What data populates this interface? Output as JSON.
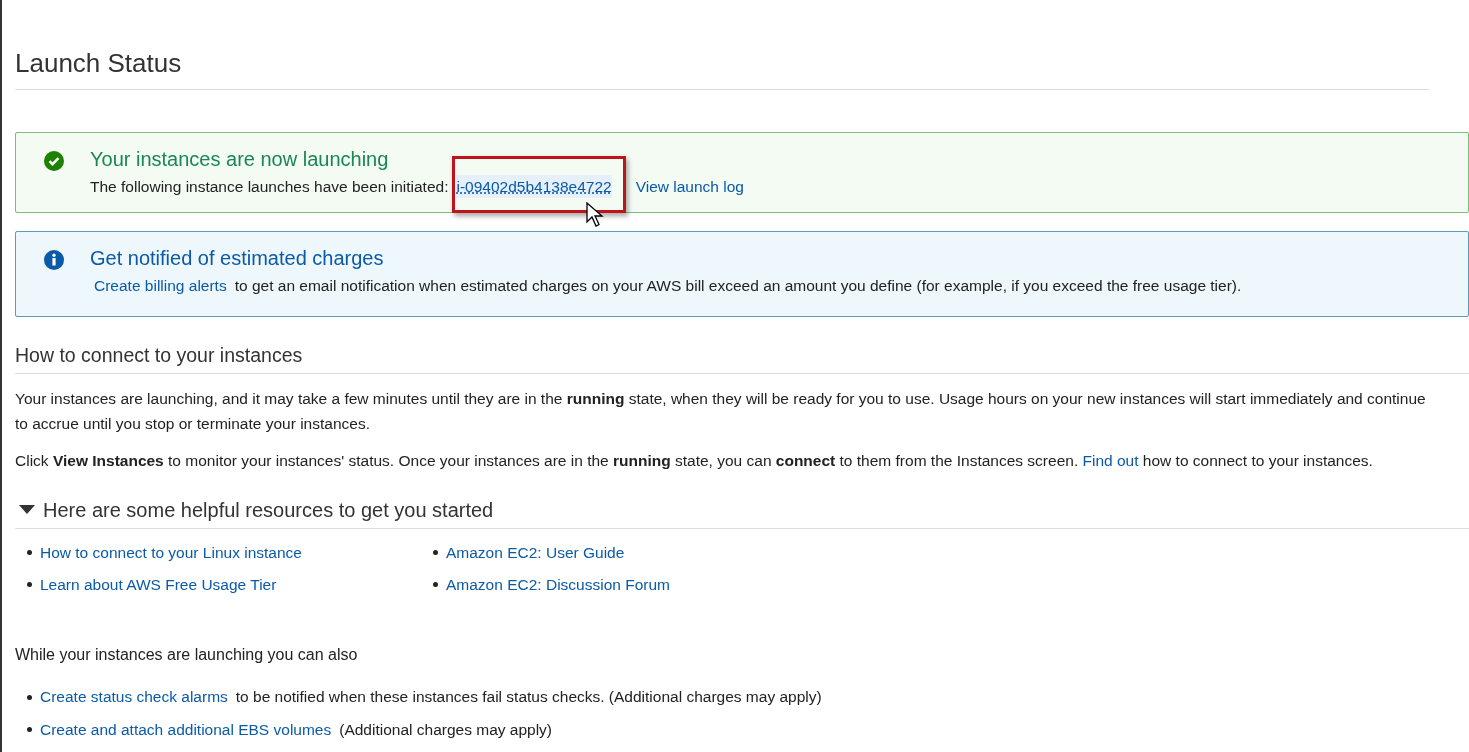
{
  "title": "Launch Status",
  "success_alert": {
    "heading": "Your instances are now launching",
    "text": "The following instance launches have been initiated:",
    "instance_link": "i-09402d5b4138e4722",
    "highlighted": true,
    "log_link": "View launch log"
  },
  "info_alert": {
    "heading": "Get notified of estimated charges",
    "link": "Create billing alerts",
    "text": "to get an email notification when estimated charges on your AWS bill exceed an amount you define (for example, if you exceed the free usage tier)."
  },
  "connect_section": {
    "heading": "How to connect to your instances",
    "paragraph_1": "Your instances are launching, and it may take a few minutes until they are in the **running** state, when they will be ready for you to use. Usage hours on your new instances will start immediately and continue to accrue until you stop or terminate your instances.",
    "paragraph_2": {
      "before": "Click **View Instances** to monitor your instances' status. Once your instances are in the **running** state, you can **connect** to them from the Instances screen.",
      "link": "Find out",
      "after": "how to connect to your instances."
    }
  },
  "resources": {
    "heading": "Here are some helpful resources to get you started",
    "expanded": true,
    "links": [
      [
        "How to connect to your Linux instance",
        "Learn about AWS Free Usage Tier"
      ],
      [
        "Amazon EC2: User Guide",
        "Amazon EC2: Discussion Forum"
      ]
    ]
  },
  "also": {
    "heading": "While your instances are launching you can also",
    "items": [
      {
        "link": "Create status check alarms",
        "text": "to be notified when these instances fail status checks. (Additional charges may apply)"
      },
      {
        "link": "Create and attach additional EBS volumes",
        "text": "(Additional charges may apply)"
      }
    ]
  }
}
